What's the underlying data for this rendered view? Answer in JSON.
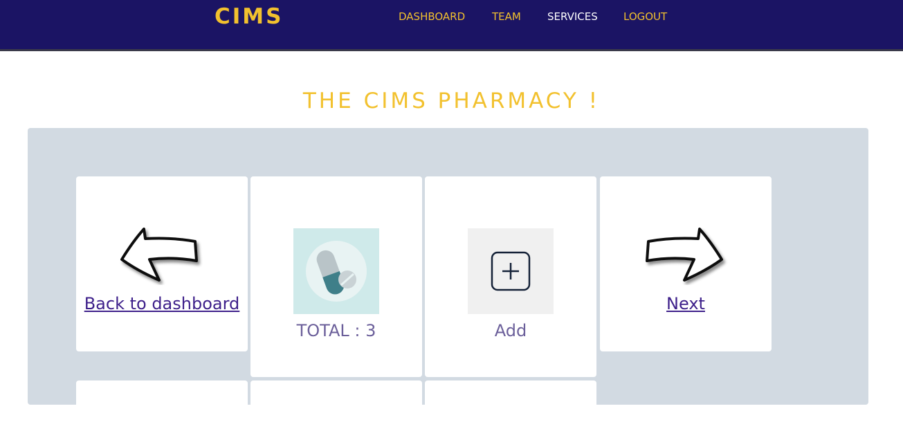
{
  "header": {
    "brand": "CIMS",
    "nav": [
      {
        "label": "DASHBOARD",
        "active": false
      },
      {
        "label": "TEAM",
        "active": false
      },
      {
        "label": "SERVICES",
        "active": true
      },
      {
        "label": "LOGOUT",
        "active": false
      }
    ]
  },
  "main": {
    "title": "THE CIMS PHARMACY !",
    "cards": {
      "back_label": "Back to dashboard",
      "total_label": "TOTAL : 3",
      "add_label": "Add",
      "next_label": "Next"
    }
  },
  "icons": {
    "back": "arrow-left-icon",
    "medicine": "pill-capsule-icon",
    "add": "plus-square-icon",
    "next": "arrow-right-icon"
  },
  "colors": {
    "navbar_bg": "#1b1464",
    "accent_yellow": "#f2c12e",
    "panel_bg": "#d2dae2",
    "link_purple": "#3d1f8a",
    "caption_purple": "#6b5f9a",
    "pill_tile_bg": "#cfeaea",
    "add_tile_bg": "#f0f0f0"
  }
}
